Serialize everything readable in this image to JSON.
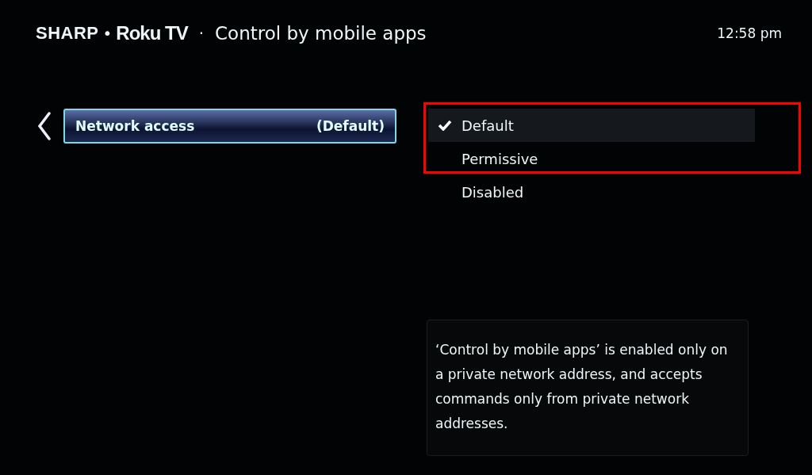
{
  "header": {
    "brand_left": "SHARP",
    "brand_dot": "•",
    "brand_right": "Roku TV",
    "separator": "·",
    "title": "Control by mobile apps",
    "time": "12:58 pm"
  },
  "menu": {
    "items": [
      {
        "label": "Network access",
        "value": "(Default)",
        "selected": true
      }
    ]
  },
  "options": [
    {
      "label": "Default",
      "checked": true,
      "selected": true
    },
    {
      "label": "Permissive",
      "checked": false,
      "selected": false
    },
    {
      "label": "Disabled",
      "checked": false,
      "selected": false
    }
  ],
  "info": "‘Control by mobile apps’ is enabled only on a private network address, and accepts commands only from private network addresses."
}
